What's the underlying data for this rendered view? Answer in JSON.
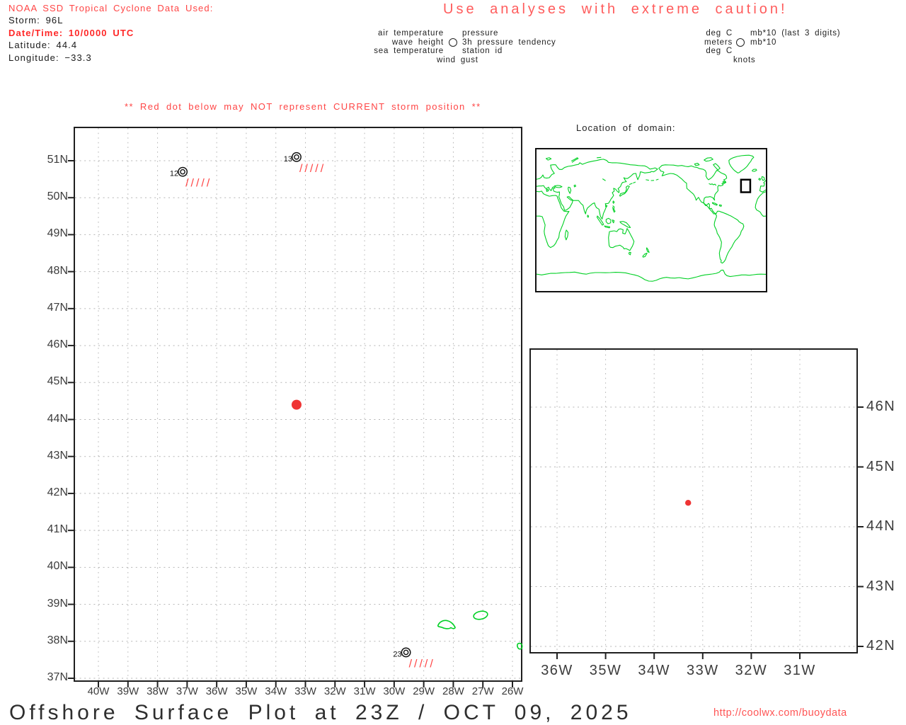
{
  "storm_info": {
    "title": "NOAA SSD Tropical Cyclone Data Used:",
    "storm_line": "Storm: 96L",
    "datetime_line": "Date/Time: 10/0000 UTC",
    "latitude_line": "Latitude: 44.4",
    "longitude_line": "Longitude: −33.3"
  },
  "caution_banner": "Use analyses with extreme caution!",
  "station_model_legend": {
    "left_labels": [
      "air temperature",
      "wave height",
      "sea temperature"
    ],
    "right_labels": [
      "pressure",
      "3h pressure tendency",
      "station id"
    ],
    "bottom_label": "wind gust"
  },
  "units_legend": {
    "left_labels": [
      "deg C",
      "meters",
      "deg C"
    ],
    "right_labels": [
      "mb*10 (last 3 digits)",
      "mb*10"
    ],
    "bottom_label": "knots"
  },
  "warning_text": "** Red dot below may NOT represent CURRENT storm position **",
  "inset": {
    "title": "Location of domain:"
  },
  "footer": {
    "title": "Offshore Surface Plot at 23Z / OCT 09, 2025",
    "url": "http://coolwx.com/buoydata"
  },
  "colors": {
    "red_text": "#ff4545",
    "storm_dot": "#ef3434",
    "green_land": "#00d024",
    "grid_gray": "#b5b5b5",
    "axis_tick": "#222222"
  },
  "chart_data": [
    {
      "type": "scatter",
      "name": "main_offshore_surface_plot",
      "x_tick_labels": [
        "40W",
        "39W",
        "38W",
        "37W",
        "36W",
        "35W",
        "34W",
        "33W",
        "32W",
        "31W",
        "30W",
        "29W",
        "28W",
        "27W",
        "26W"
      ],
      "x_tick_lons": [
        -40,
        -39,
        -38,
        -37,
        -36,
        -35,
        -34,
        -33,
        -32,
        -31,
        -30,
        -29,
        -28,
        -27,
        -26
      ],
      "y_tick_labels": [
        "51N",
        "50N",
        "49N",
        "48N",
        "47N",
        "46N",
        "45N",
        "44N",
        "43N",
        "42N",
        "41N",
        "40N",
        "39N",
        "38N",
        "37N"
      ],
      "y_tick_lats": [
        51,
        50,
        49,
        48,
        47,
        46,
        45,
        44,
        43,
        42,
        41,
        40,
        39,
        38,
        37
      ],
      "xlim_lon": [
        -40.8,
        -25.7
      ],
      "ylim_lat": [
        36.9,
        51.9
      ],
      "grid": true,
      "storm_point": {
        "lat": 44.4,
        "lon": -33.3
      },
      "stations": [
        {
          "id": "12",
          "lat": 50.7,
          "lon": -37.15,
          "missing_marks": "/////"
        },
        {
          "id": "13",
          "lat": 51.1,
          "lon": -33.3,
          "missing_marks": "/////"
        },
        {
          "id": "23",
          "lat": 37.7,
          "lon": -29.6,
          "missing_marks": "/////"
        }
      ]
    },
    {
      "type": "scatter",
      "name": "zoomed_storm_area_plot",
      "x_tick_labels": [
        "36W",
        "35W",
        "34W",
        "33W",
        "32W",
        "31W"
      ],
      "x_tick_lons": [
        -36,
        -35,
        -34,
        -33,
        -32,
        -31
      ],
      "y_tick_labels": [
        "46N",
        "45N",
        "44N",
        "43N",
        "42N"
      ],
      "y_tick_lats": [
        46,
        45,
        44,
        43,
        42
      ],
      "xlim_lon": [
        -36.5,
        -29.8
      ],
      "ylim_lat": [
        41.9,
        47.0
      ],
      "grid": true,
      "storm_point": {
        "lat": 44.4,
        "lon": -33.3
      }
    }
  ]
}
